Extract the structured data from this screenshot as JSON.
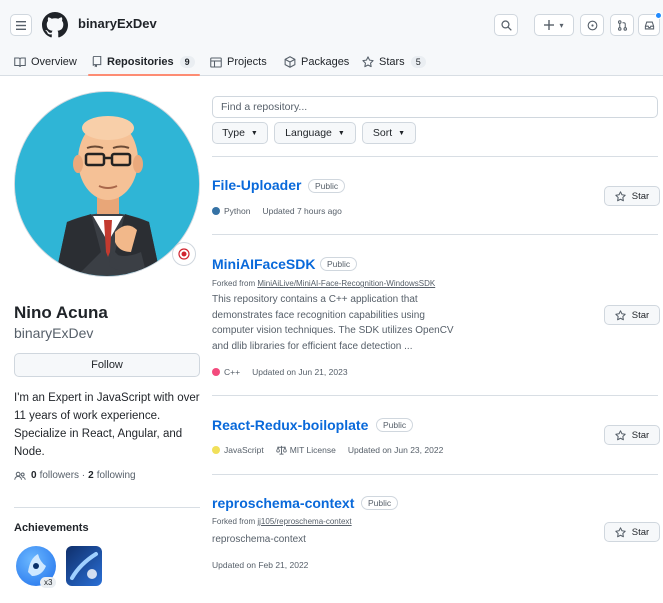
{
  "header": {
    "username": "binaryExDev",
    "icons": [
      "hamburger-icon",
      "github-logo",
      "search-icon",
      "plus-icon",
      "issues-icon",
      "pull-requests-icon",
      "inbox-icon"
    ],
    "plus_caret": "▾"
  },
  "tabs": [
    {
      "label": "Overview",
      "icon": "book-icon"
    },
    {
      "label": "Repositories",
      "icon": "repo-icon",
      "count": "9",
      "active": true
    },
    {
      "label": "Projects",
      "icon": "table-icon"
    },
    {
      "label": "Packages",
      "icon": "package-icon"
    },
    {
      "label": "Stars",
      "icon": "star-icon",
      "count": "5"
    }
  ],
  "profile": {
    "full_name": "Nino Acuna",
    "handle": "binaryExDev",
    "follow_label": "Follow",
    "bio": "I'm an Expert in JavaScript with over 11 years of work experience. Specialize in React, Angular, and Node.",
    "followers_count": "0",
    "followers_label": "followers ·",
    "following_count": "2",
    "following_label": "following",
    "achievements_title": "Achievements",
    "achievement_badge_count": "x3"
  },
  "filters": {
    "search_placeholder": "Find a repository...",
    "type_label": "Type",
    "language_label": "Language",
    "sort_label": "Sort"
  },
  "repos": [
    {
      "name": "File-Uploader",
      "visibility": "Public",
      "language": "Python",
      "language_color": "#3572A5",
      "updated": "Updated 7 hours ago",
      "star_label": "Star"
    },
    {
      "name": "MiniAIFaceSDK",
      "visibility": "Public",
      "forked_prefix": "Forked from",
      "forked_from": "MiniAiLive/MiniAI-Face-Recognition-WindowsSDK",
      "description_lines": [
        "This repository contains a C++ application that",
        "demonstrates face recognition capabilities using",
        "computer vision techniques. The SDK utilizes OpenCV",
        "and dlib libraries for efficient face detection ..."
      ],
      "language": "C++",
      "language_color": "#f34b7d",
      "updated": "Updated on Jun 21, 2023",
      "star_label": "Star"
    },
    {
      "name": "React-Redux-boiloplate",
      "visibility": "Public",
      "language": "JavaScript",
      "language_color": "#f1e05a",
      "license": "MIT License",
      "updated": "Updated on Jun 23, 2022",
      "star_label": "Star"
    },
    {
      "name": "reproschema-context",
      "visibility": "Public",
      "forked_prefix": "Forked from",
      "forked_from": "jj105/reproschema-context",
      "description_lines": [
        "reproschema-context"
      ],
      "updated": "Updated on Feb 21, 2022",
      "star_label": "Star"
    }
  ],
  "colors": {
    "link": "#0969da",
    "tab_underline": "#fd8c73",
    "avatar_bg": "#2fb5d6",
    "notification": "#218bff"
  }
}
